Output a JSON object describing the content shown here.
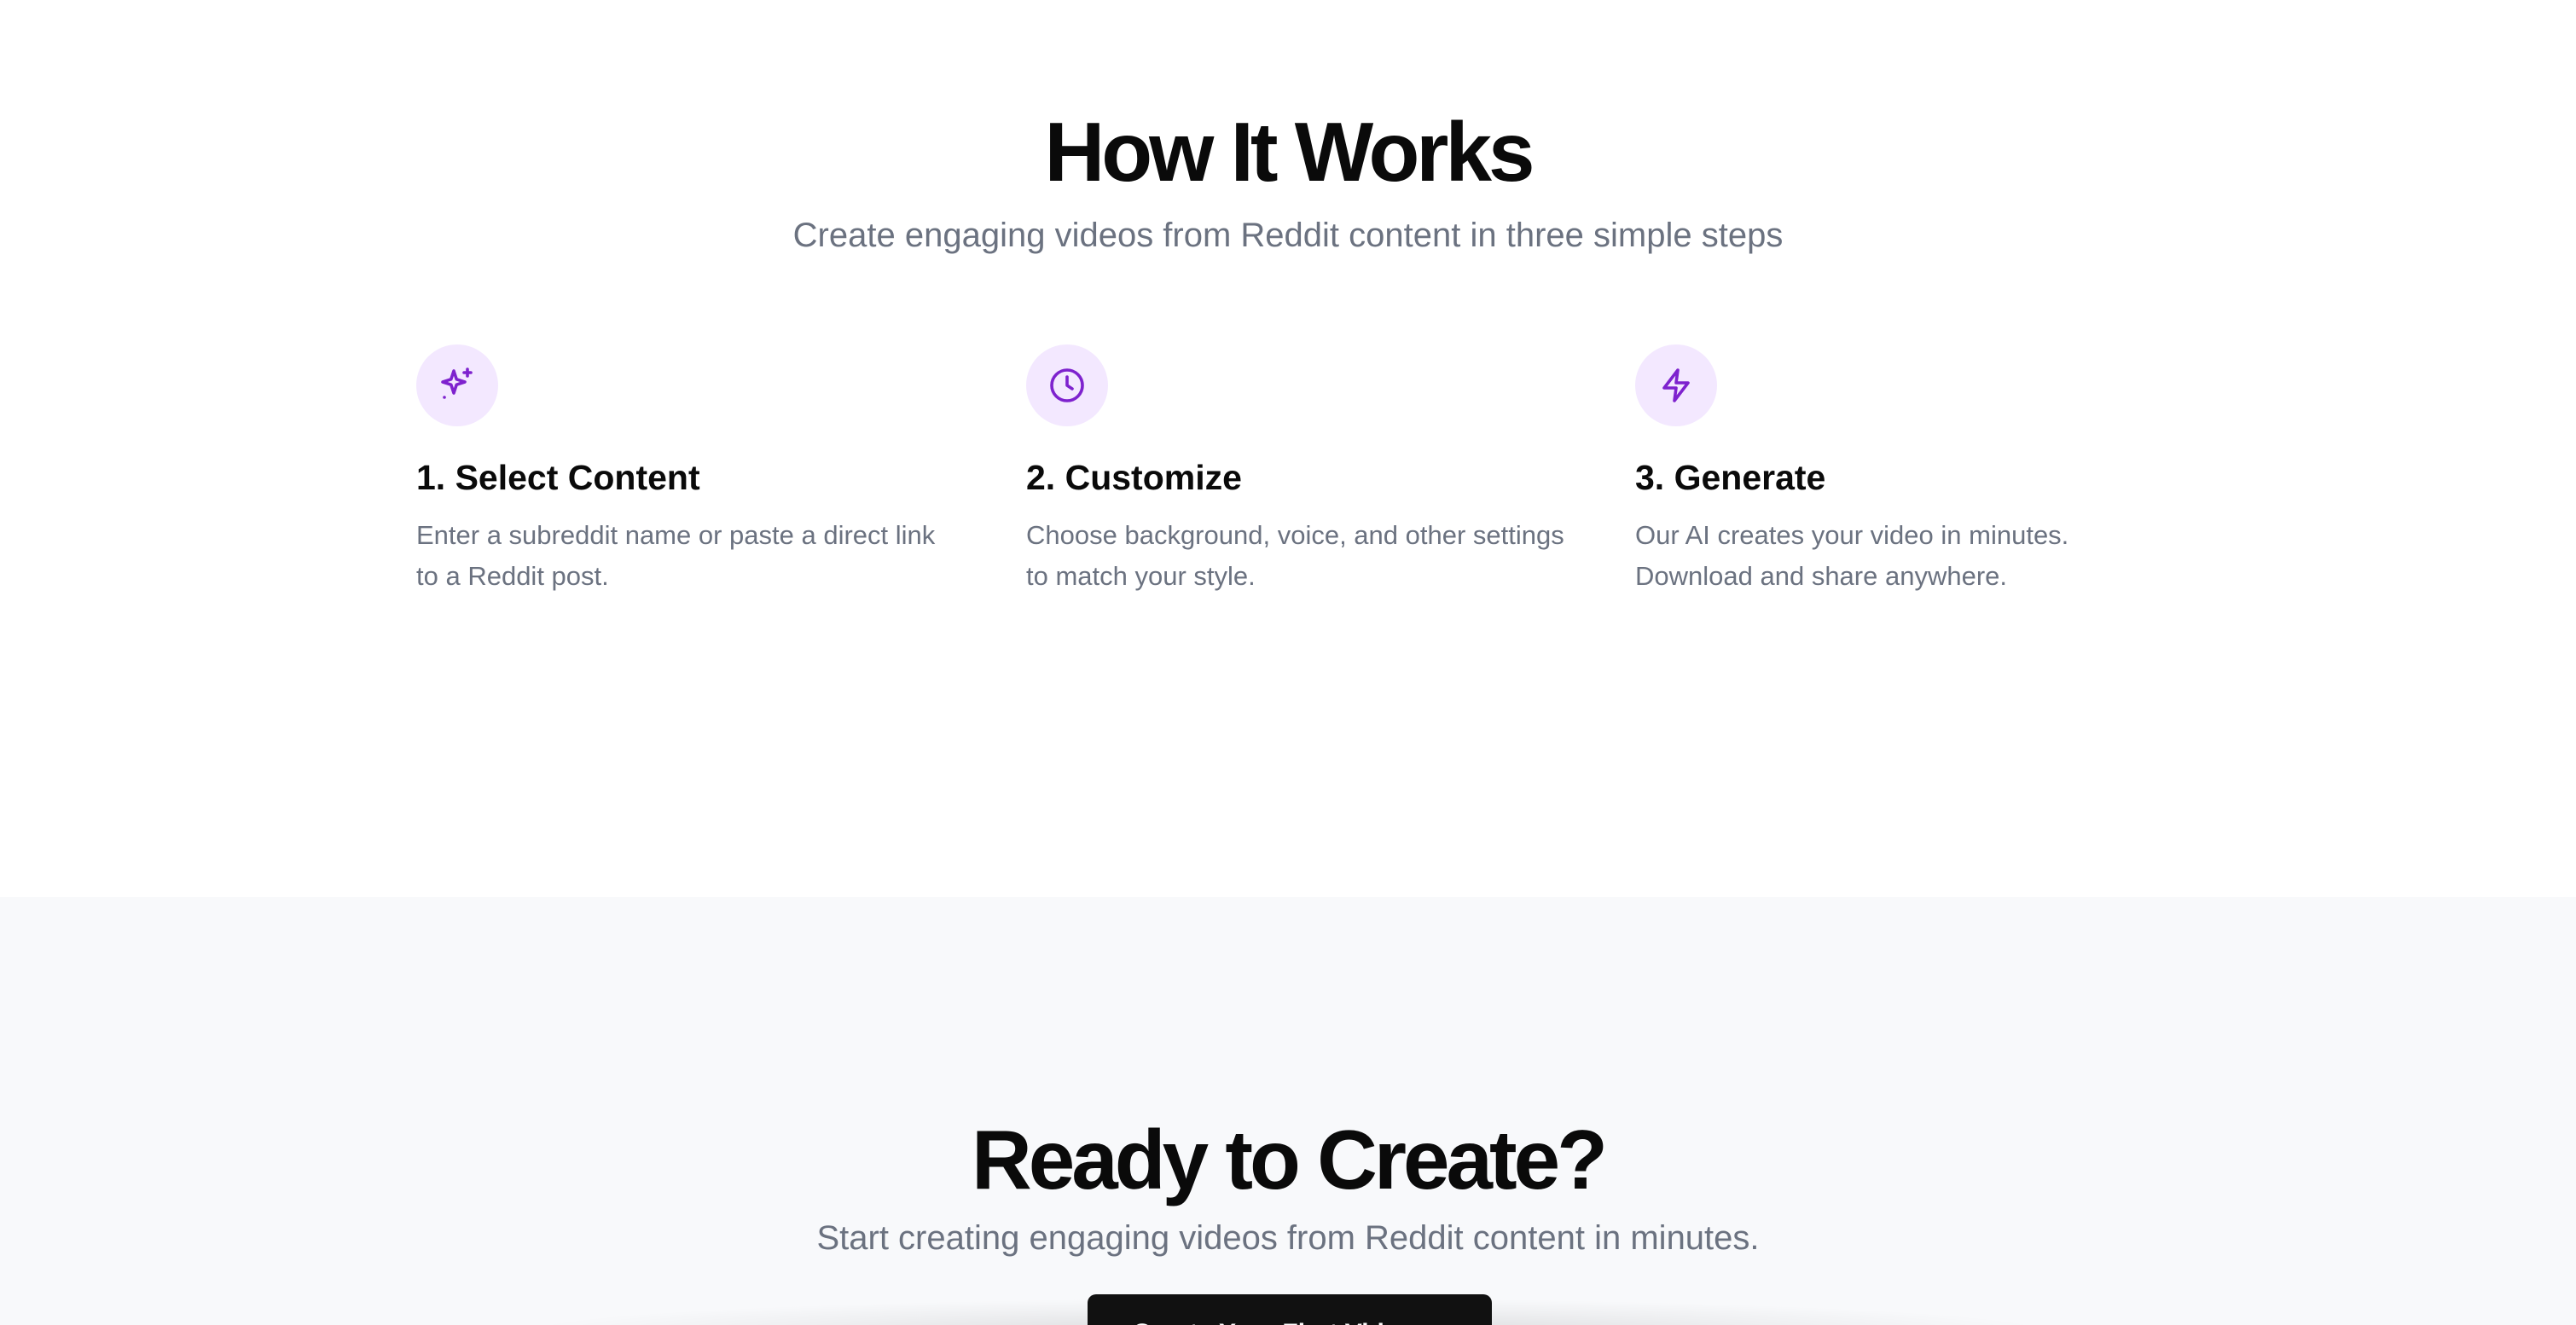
{
  "how_it_works": {
    "title": "How It Works",
    "subtitle": "Create engaging videos from Reddit content in three simple steps",
    "icon_bg_color": "#f3e8ff",
    "icon_color": "#7e22ce",
    "steps": [
      {
        "icon": "sparkles-icon",
        "title": "1. Select Content",
        "description": "Enter a subreddit name or paste a direct link to a Reddit post."
      },
      {
        "icon": "clock-icon",
        "title": "2. Customize",
        "description": "Choose background, voice, and other settings to match your style."
      },
      {
        "icon": "lightning-icon",
        "title": "3. Generate",
        "description": "Our AI creates your video in minutes. Download and share anywhere."
      }
    ]
  },
  "cta": {
    "title": "Ready to Create?",
    "subtitle": "Start creating engaging videos from Reddit content in minutes.",
    "button_label": "Create Your First Video →",
    "button_color": "#111111",
    "section_bg_color": "#f8f9fb"
  }
}
